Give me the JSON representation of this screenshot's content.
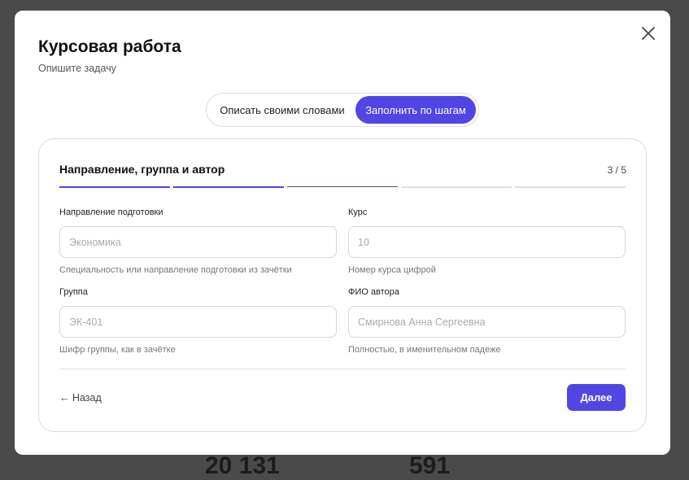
{
  "background": {
    "numbers": [
      "20 131",
      "591"
    ]
  },
  "modal": {
    "title": "Курсовая работа",
    "subtitle": "Опишите задачу",
    "close_icon": "close-icon",
    "mode_toggle": {
      "options": [
        "Описать своими словами",
        "Заполнить по шагам"
      ],
      "selected": "Заполнить по шагам"
    },
    "step": {
      "title": "Направление, группа и автор",
      "counter": "3 / 5",
      "current": 3,
      "total": 5
    },
    "fields": [
      {
        "label": "Направление подготовки",
        "value": "",
        "placeholder": "Экономика",
        "hint": "Специальность или направление подготовки из зачётки"
      },
      {
        "label": "Курс",
        "value": "",
        "placeholder": "10",
        "hint": "Номер курса цифрой"
      },
      {
        "label": "Группа",
        "value": "",
        "placeholder": "ЭК-401",
        "hint": "Шифр группы, как в зачётке"
      },
      {
        "label": "ФИО автора",
        "value": "",
        "placeholder": "Смирнова Анна Сергеевна",
        "hint": "Полностью, в именительном падеже"
      }
    ],
    "back_label": "← Назад",
    "next_label": "Далее"
  },
  "colors": {
    "accent": "#5046e4",
    "overlay": "#4a4a4a"
  }
}
